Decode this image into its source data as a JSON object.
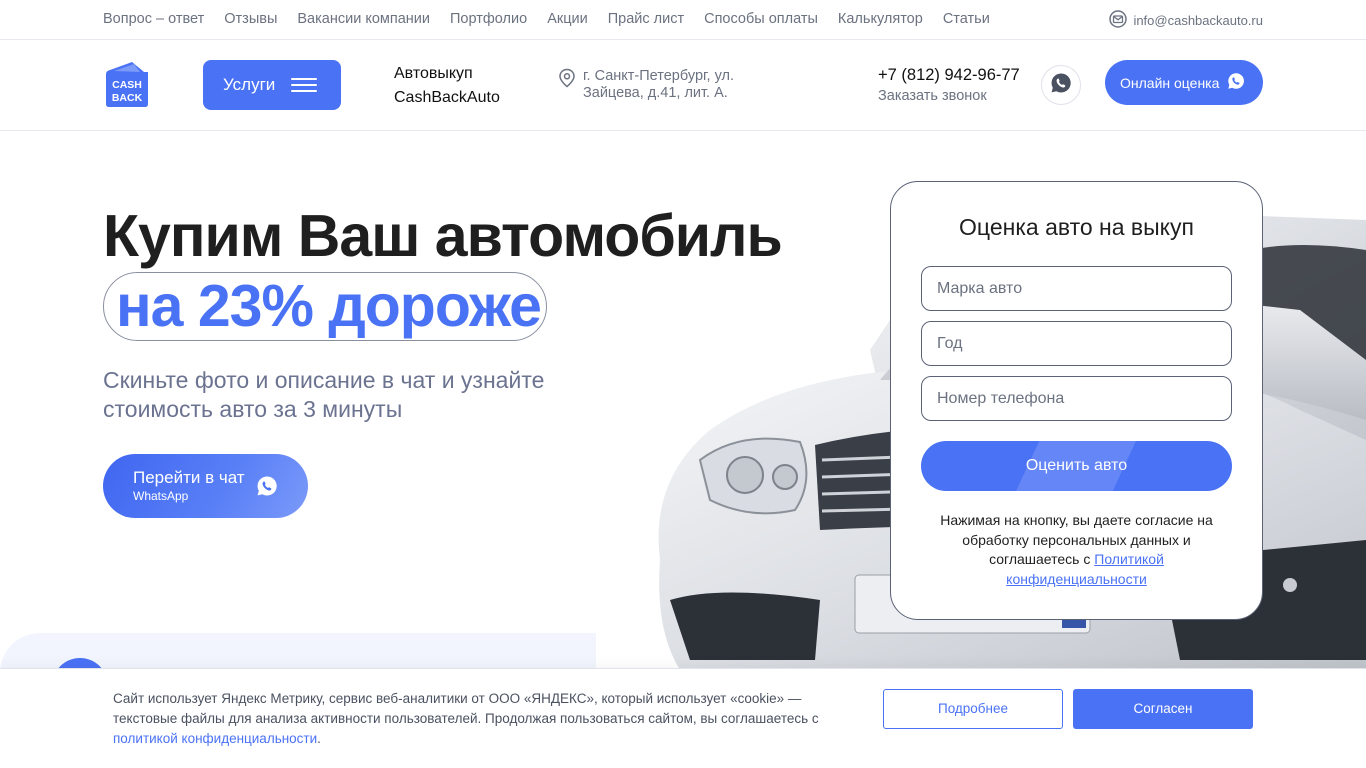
{
  "topnav": {
    "links": [
      "Вопрос – ответ",
      "Отзывы",
      "Вакансии компании",
      "Портфолио",
      "Акции",
      "Прайс лист",
      "Способы оплаты",
      "Калькулятор",
      "Статьи"
    ],
    "email": "info@cashbackauto.ru"
  },
  "header": {
    "logo_text_1": "CASH",
    "logo_text_2": "BACK",
    "services_label": "Услуги",
    "brand_line1": "Автовыкуп",
    "brand_line2": "CashBackAuto",
    "address": "г. Санкт-Петербург, ул. Зайцева, д.41, лит. А.",
    "phone": "+7 (812) 942-96-77",
    "call_label": "Заказать звонок",
    "online_label": "Онлайн оценка"
  },
  "hero": {
    "title": "Купим Ваш автомобиль",
    "highlight": "на 23% дороже",
    "subtitle": "Скиньте фото и описание в чат и узнайте стоимость авто за 3 минуты",
    "chat_label": "Перейти в чат",
    "chat_sublabel": "WhatsApp"
  },
  "form": {
    "title": "Оценка авто на выкуп",
    "brand_placeholder": "Марка авто",
    "year_placeholder": "Год",
    "phone_placeholder": "Номер телефона",
    "submit_label": "Оценить авто",
    "consent_text": "Нажимая на кнопку, вы даете согласие на обработку персональных данных и соглашаетесь с ",
    "consent_link": "Политикой конфиденциальности"
  },
  "cookie": {
    "text": "Сайт использует Яндекс Метрику, сервис веб-аналитики от ООО «ЯНДЕКС», который использует «cookie» — текстовые файлы для анализа активности пользователей. Продолжая пользоваться сайтом, вы соглашаетесь с ",
    "link": "политикой конфиденциальности",
    "link_suffix": ".",
    "more_label": "Подробнее",
    "agree_label": "Согласен"
  },
  "colors": {
    "accent": "#4a72f5",
    "text_gray": "#6b7280",
    "title": "#1f1f1f"
  }
}
